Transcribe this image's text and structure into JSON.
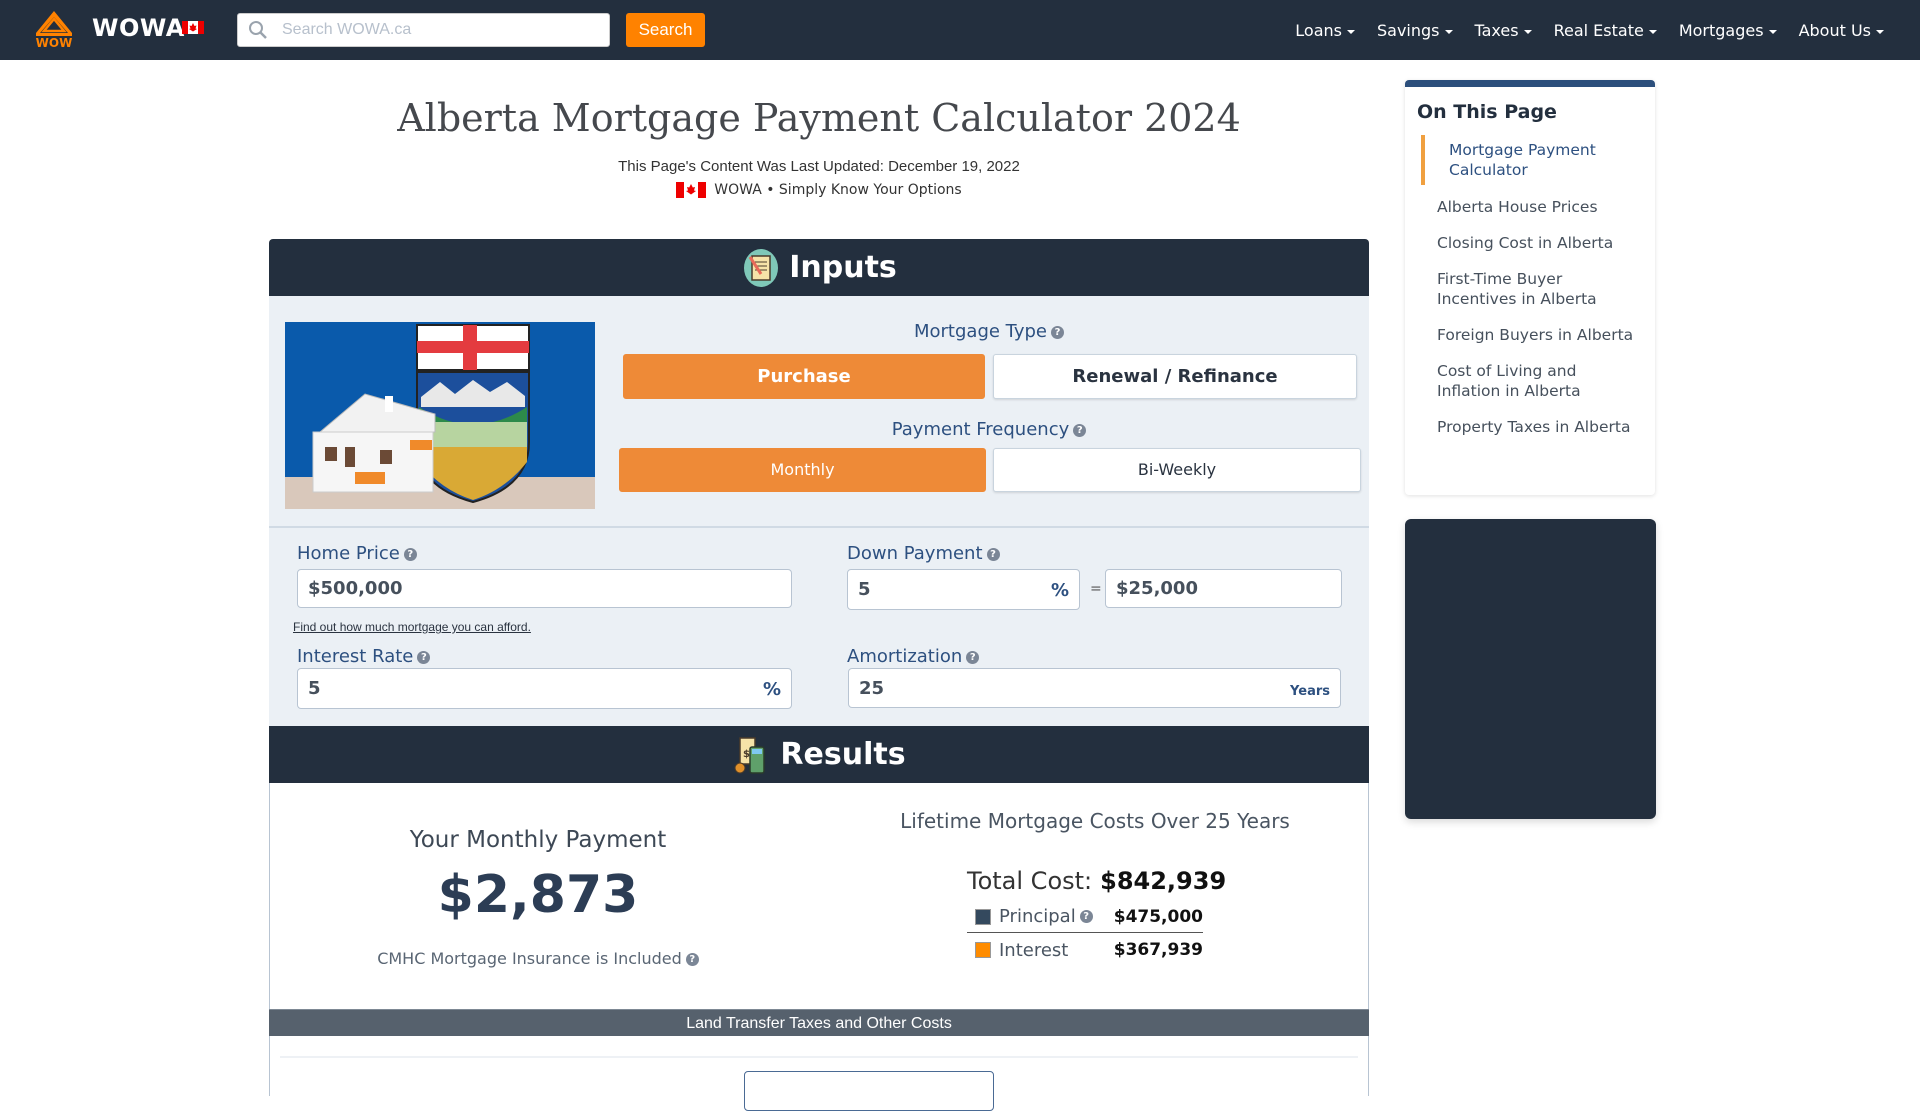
{
  "navbar": {
    "brand": "WOWA",
    "search_placeholder": "Search WOWA.ca",
    "search_value": "",
    "search_button": "Search",
    "menu": [
      {
        "label": "Loans"
      },
      {
        "label": "Savings"
      },
      {
        "label": "Taxes"
      },
      {
        "label": "Real Estate"
      },
      {
        "label": "Mortgages"
      },
      {
        "label": "About Us"
      }
    ]
  },
  "header": {
    "title": "Alberta Mortgage Payment Calculator 2024",
    "updated": "This Page's Content Was Last Updated: December 19, 2022",
    "tagline": "WOWA • Simply Know Your Options"
  },
  "inputs": {
    "heading": "Inputs",
    "mortgage_type": {
      "label": "Mortgage Type",
      "options": [
        "Purchase",
        "Renewal / Refinance"
      ],
      "selected": "Purchase"
    },
    "payment_frequency": {
      "label": "Payment Frequency",
      "options": [
        "Monthly",
        "Bi-Weekly"
      ],
      "selected": "Monthly"
    },
    "home_price": {
      "label": "Home Price",
      "value": "$500,000"
    },
    "afford_link": "Find out how much mortgage you can afford.",
    "down_payment": {
      "label": "Down Payment",
      "percent": "5",
      "percent_unit": "%",
      "equals": "=",
      "amount": "$25,000"
    },
    "interest_rate": {
      "label": "Interest Rate",
      "value": "5",
      "unit": "%"
    },
    "amortization": {
      "label": "Amortization",
      "value": "25",
      "unit": "Years"
    }
  },
  "results": {
    "heading": "Results",
    "payment_title": "Your Monthly Payment",
    "payment_amount": "$2,873",
    "insurance_note": "CMHC Mortgage Insurance is Included",
    "lifetime_title": "Lifetime Mortgage Costs Over 25 Years",
    "total_label": "Total Cost:",
    "total_value": "$842,939",
    "principal_label": "Principal",
    "principal_value": "$475,000",
    "principal_color": "#34495e",
    "interest_label": "Interest",
    "interest_value": "$367,939",
    "interest_color": "#ff8c00",
    "ltt_bar": "Land Transfer Taxes and Other Costs"
  },
  "toc": {
    "title": "On This Page",
    "items": [
      {
        "label": "Mortgage Payment Calculator",
        "active": true
      },
      {
        "label": "Alberta House Prices"
      },
      {
        "label": "Closing Cost in Alberta"
      },
      {
        "label": "First-Time Buyer Incentives in Alberta"
      },
      {
        "label": "Foreign Buyers in Alberta"
      },
      {
        "label": "Cost of Living and Inflation in Alberta"
      },
      {
        "label": "Property Taxes in Alberta"
      }
    ]
  },
  "colors": {
    "navbar": "#232f3e",
    "accent_orange": "#ee8a37",
    "search_button": "#ff8200",
    "label_blue": "#2d5080"
  }
}
